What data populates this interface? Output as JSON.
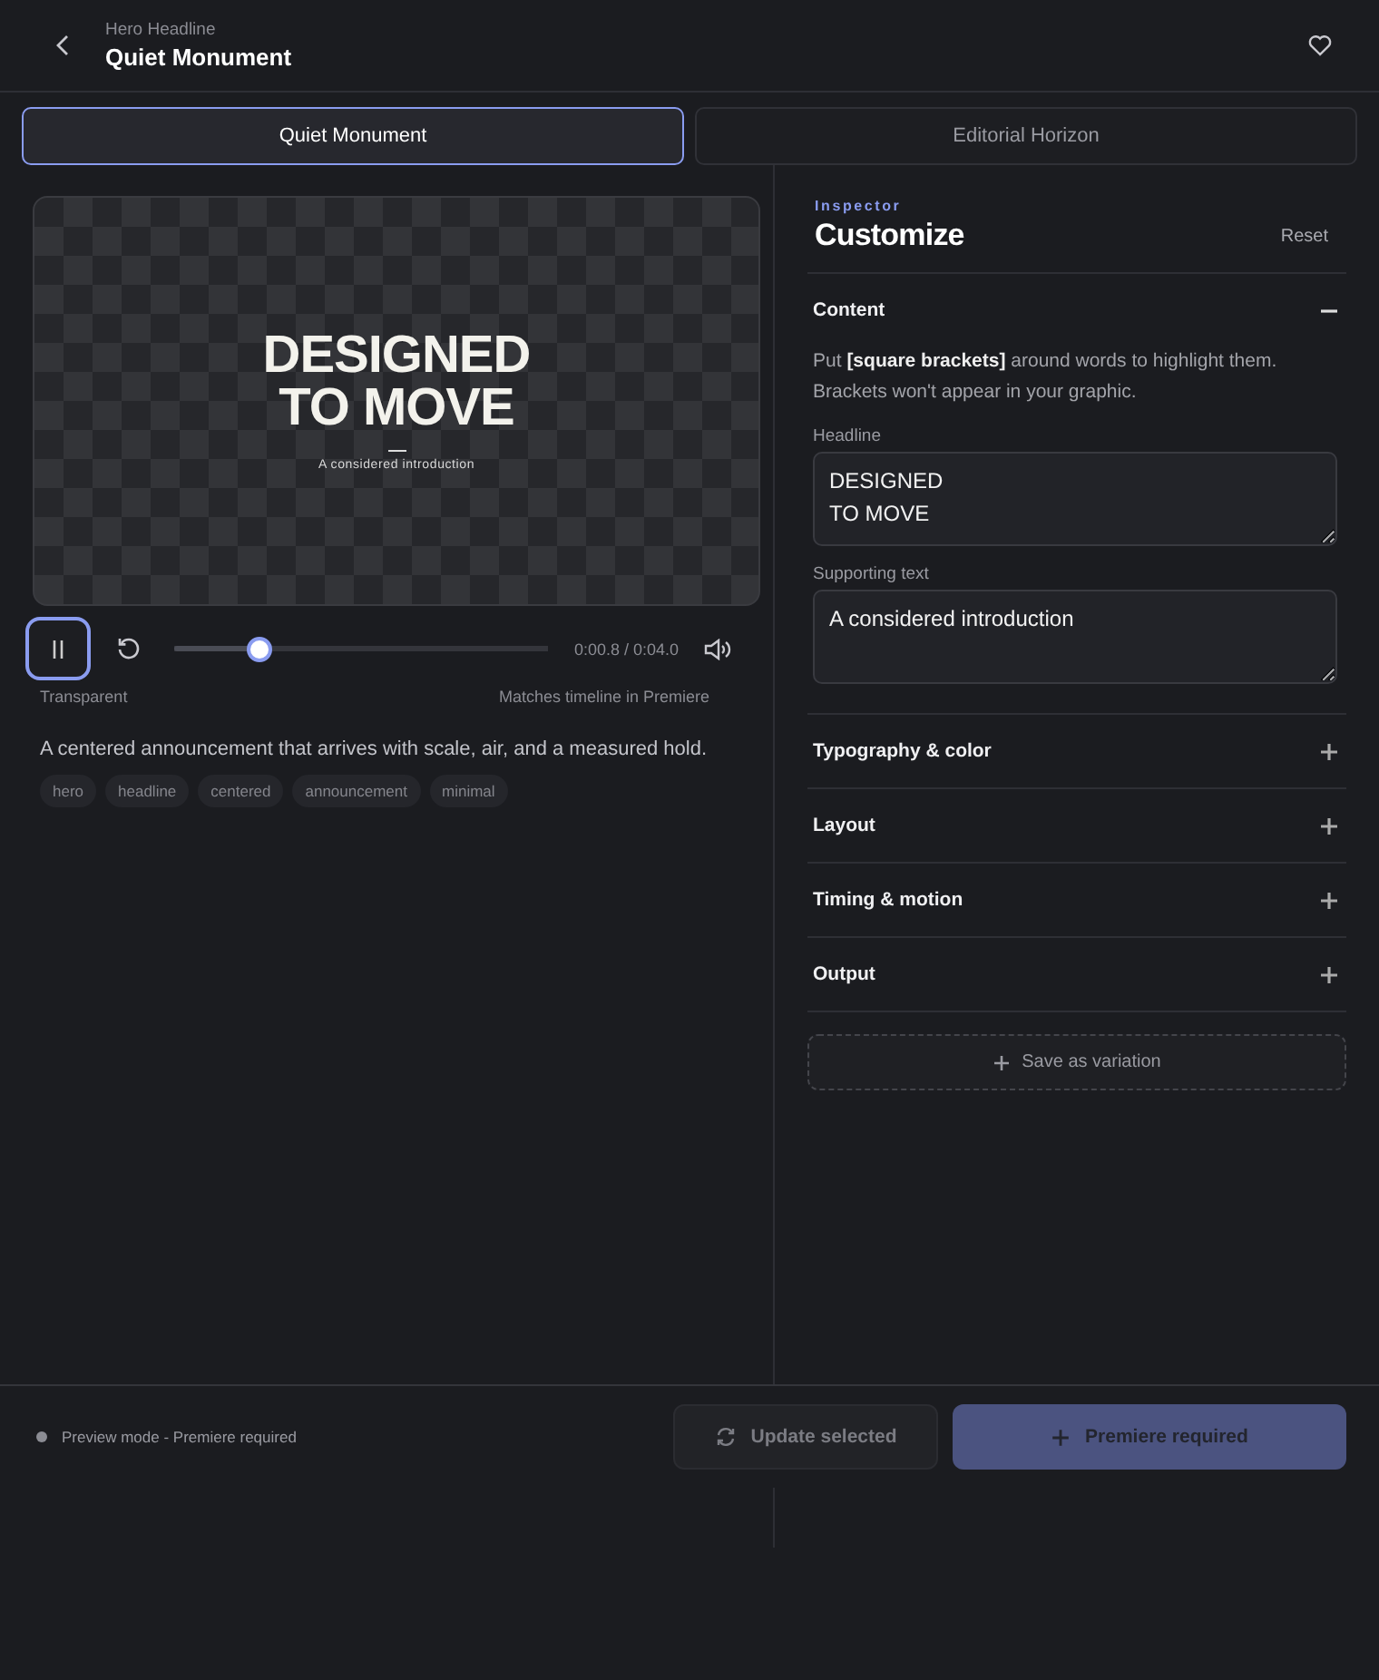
{
  "header": {
    "eyebrow": "Hero Headline",
    "title": "Quiet Monument"
  },
  "tabs": [
    {
      "label": "Quiet Monument",
      "selected": true
    },
    {
      "label": "Editorial Horizon",
      "selected": false
    }
  ],
  "preview": {
    "headline_lines": [
      "DESIGNED",
      "TO MOVE"
    ],
    "subtitle": "A considered introduction"
  },
  "player": {
    "playing": true,
    "level": 0.23,
    "time": "0:00.8 / 0:04.0"
  },
  "background_label": "Transparent",
  "timeline_note": "Matches timeline in Premiere",
  "description": "A centered announcement that arrives with scale, air, and a measured hold.",
  "tags": [
    "hero",
    "headline",
    "centered",
    "announcement",
    "minimal"
  ],
  "inspector": {
    "eyebrow": "Inspector",
    "title": "Customize",
    "reset": "Reset"
  },
  "sections": [
    {
      "title": "Content",
      "expanded": true,
      "hint": "Put **[square brackets]** around words to highlight them. Brackets won't appear in your graphic.",
      "fields": [
        {
          "label": "Headline",
          "value": "DESIGNED\nTO MOVE"
        },
        {
          "label": "Supporting text",
          "value": "A considered introduction"
        }
      ]
    },
    {
      "title": "Typography & color",
      "expanded": false
    },
    {
      "title": "Layout",
      "expanded": false
    },
    {
      "title": "Timing & motion",
      "expanded": false
    },
    {
      "title": "Output",
      "expanded": false
    }
  ],
  "save_variation": "Save as variation",
  "footer": {
    "status": "Preview mode - Premiere required",
    "buttons": [
      {
        "label": "Update selected",
        "kind": "secondary",
        "disabled": true
      },
      {
        "label": "Premiere required",
        "kind": "primary",
        "disabled": true
      }
    ]
  }
}
